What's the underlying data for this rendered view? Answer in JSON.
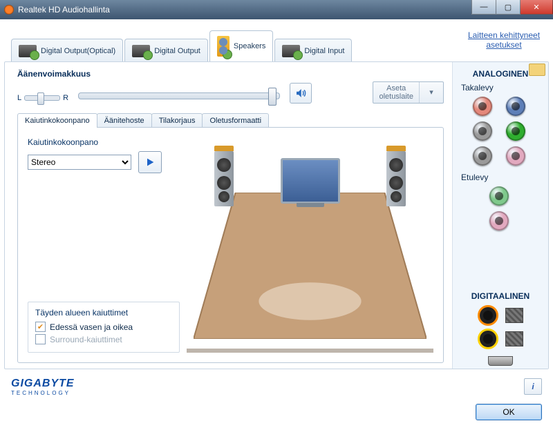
{
  "window": {
    "title": "Realtek HD Audiohallinta"
  },
  "winbtns": {
    "min": "—",
    "max": "▢",
    "close": "✕"
  },
  "device_tabs": [
    {
      "label": "Digital Output(Optical)"
    },
    {
      "label": "Digital Output"
    },
    {
      "label": "Speakers"
    },
    {
      "label": "Digital Input"
    }
  ],
  "advanced_link": "Laitteen kehittyneet asetukset",
  "volume": {
    "title": "Äänenvoimakkuus",
    "balance_left": "L",
    "balance_right": "R",
    "set_default": "Aseta\noletuslaite"
  },
  "subtabs": [
    "Kaiutinkokoonpano",
    "Äänitehoste",
    "Tilakorjaus",
    "Oletusformaatti"
  ],
  "speaker_config": {
    "label": "Kaiutinkokoonpano",
    "selected": "Stereo"
  },
  "full_range": {
    "title": "Täyden alueen kaiuttimet",
    "front": "Edessä vasen ja oikea",
    "surround": "Surround-kaiuttimet"
  },
  "rightpanel": {
    "analog_title": "ANALOGINEN",
    "rear_label": "Takalevy",
    "front_label": "Etulevy",
    "digital_title": "DIGITAALINEN",
    "jacks_rear": [
      "#e4887b",
      "#5e7fb8",
      "#9a9a9a",
      "#2fae2f",
      "#9a9a9a",
      "#e2a9bf"
    ],
    "jacks_front": [
      "#7fc98c",
      "#e2a9bf"
    ],
    "digital": [
      "#ff8a00",
      "#ffd100"
    ]
  },
  "brand": {
    "name": "GIGABYTE",
    "sub": "TECHNOLOGY"
  },
  "ok": "OK"
}
